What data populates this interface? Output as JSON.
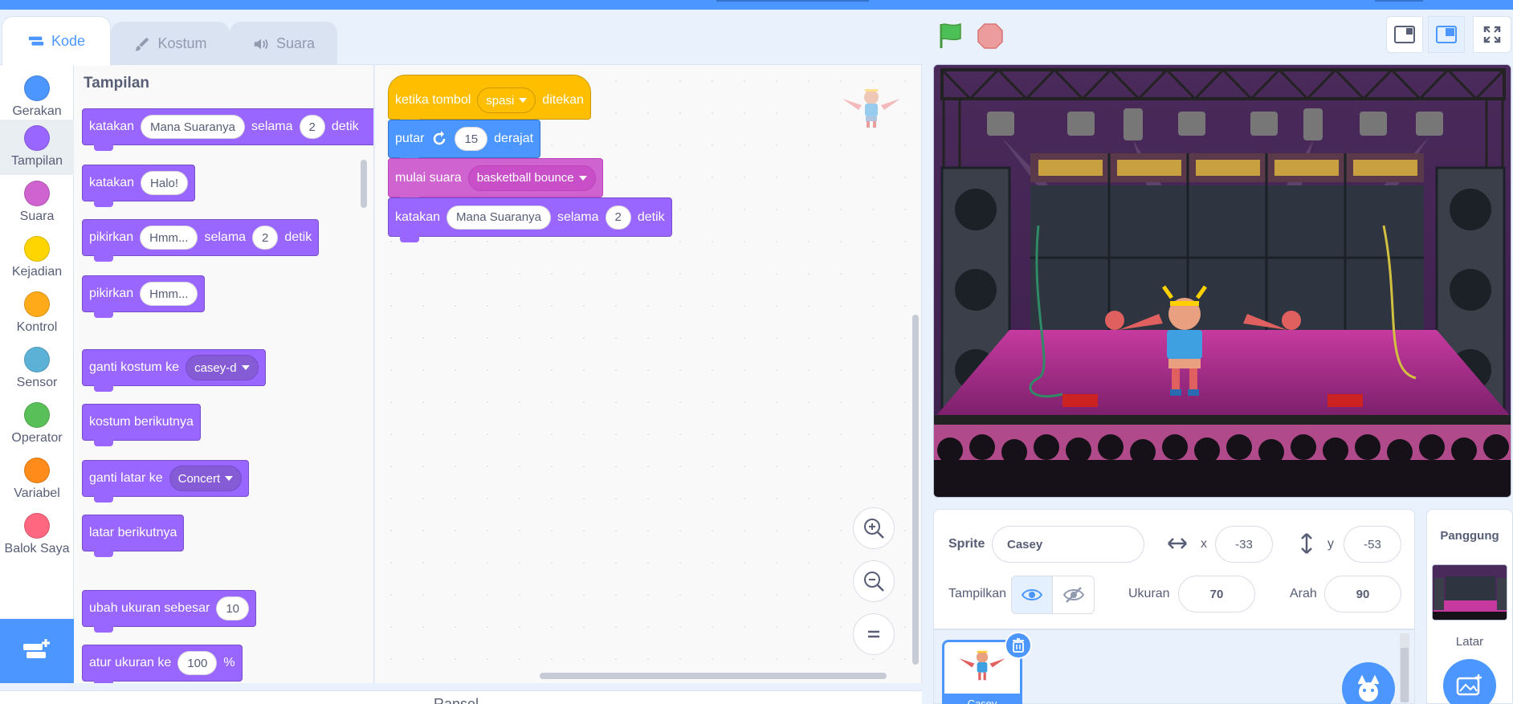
{
  "tabs": [
    {
      "label": "Kode",
      "icon": "code-icon",
      "active": true
    },
    {
      "label": "Kostum",
      "icon": "brush-icon",
      "active": false
    },
    {
      "label": "Suara",
      "icon": "speaker-icon",
      "active": false
    }
  ],
  "categories": [
    {
      "label": "Gerakan",
      "color": "#4c97ff"
    },
    {
      "label": "Tampilan",
      "color": "#9966ff"
    },
    {
      "label": "Suara",
      "color": "#cf63cf"
    },
    {
      "label": "Kejadian",
      "color": "#ffd500"
    },
    {
      "label": "Kontrol",
      "color": "#ffab19"
    },
    {
      "label": "Sensor",
      "color": "#5cb1d6"
    },
    {
      "label": "Operator",
      "color": "#59c059"
    },
    {
      "label": "Variabel",
      "color": "#ff8c1a"
    },
    {
      "label": "Balok Saya",
      "color": "#ff6680"
    }
  ],
  "flyout": {
    "title": "Tampilan",
    "blocks": {
      "say_for": {
        "t1": "katakan",
        "v1": "Mana Suaranya",
        "t2": "selama",
        "v2": "2",
        "t3": "detik"
      },
      "say": {
        "t1": "katakan",
        "v1": "Halo!"
      },
      "think_for": {
        "t1": "pikirkan",
        "v1": "Hmm...",
        "t2": "selama",
        "v2": "2",
        "t3": "detik"
      },
      "think": {
        "t1": "pikirkan",
        "v1": "Hmm..."
      },
      "switch_costume": {
        "t1": "ganti kostum ke",
        "v1": "casey-d"
      },
      "next_costume": {
        "t1": "kostum berikutnya"
      },
      "switch_backdrop": {
        "t1": "ganti latar ke",
        "v1": "Concert"
      },
      "next_backdrop": {
        "t1": "latar berikutnya"
      },
      "change_size": {
        "t1": "ubah ukuran sebesar",
        "v1": "10"
      },
      "set_size": {
        "t1": "atur ukuran ke",
        "v1": "100",
        "t2": "%"
      }
    }
  },
  "script": {
    "when_key": {
      "t1": "ketika tombol",
      "v1": "spasi",
      "t2": "ditekan"
    },
    "turn": {
      "t1": "putar",
      "v1": "15",
      "t2": "derajat"
    },
    "start_sound": {
      "t1": "mulai suara",
      "v1": "basketball bounce"
    },
    "say_for": {
      "t1": "katakan",
      "v1": "Mana Suaranya",
      "t2": "selama",
      "v2": "2",
      "t3": "detik"
    }
  },
  "bottombar": {
    "label": "Ransel"
  },
  "sprite_info": {
    "sprite_label": "Sprite",
    "sprite_name": "Casey",
    "x_label": "x",
    "x_value": "-33",
    "y_label": "y",
    "y_value": "-53",
    "show_label": "Tampilkan",
    "size_label": "Ukuran",
    "size_value": "70",
    "direction_label": "Arah",
    "direction_value": "90"
  },
  "sprite_list": [
    {
      "name": "Casey",
      "selected": true
    }
  ],
  "stage_panel": {
    "title": "Panggung",
    "backdrops_label": "Latar"
  },
  "colors": {
    "accent": "#4c97ff",
    "looks": "#9966ff",
    "events": "#ffbf00",
    "motion": "#4c97ff",
    "sound": "#cf63cf"
  }
}
